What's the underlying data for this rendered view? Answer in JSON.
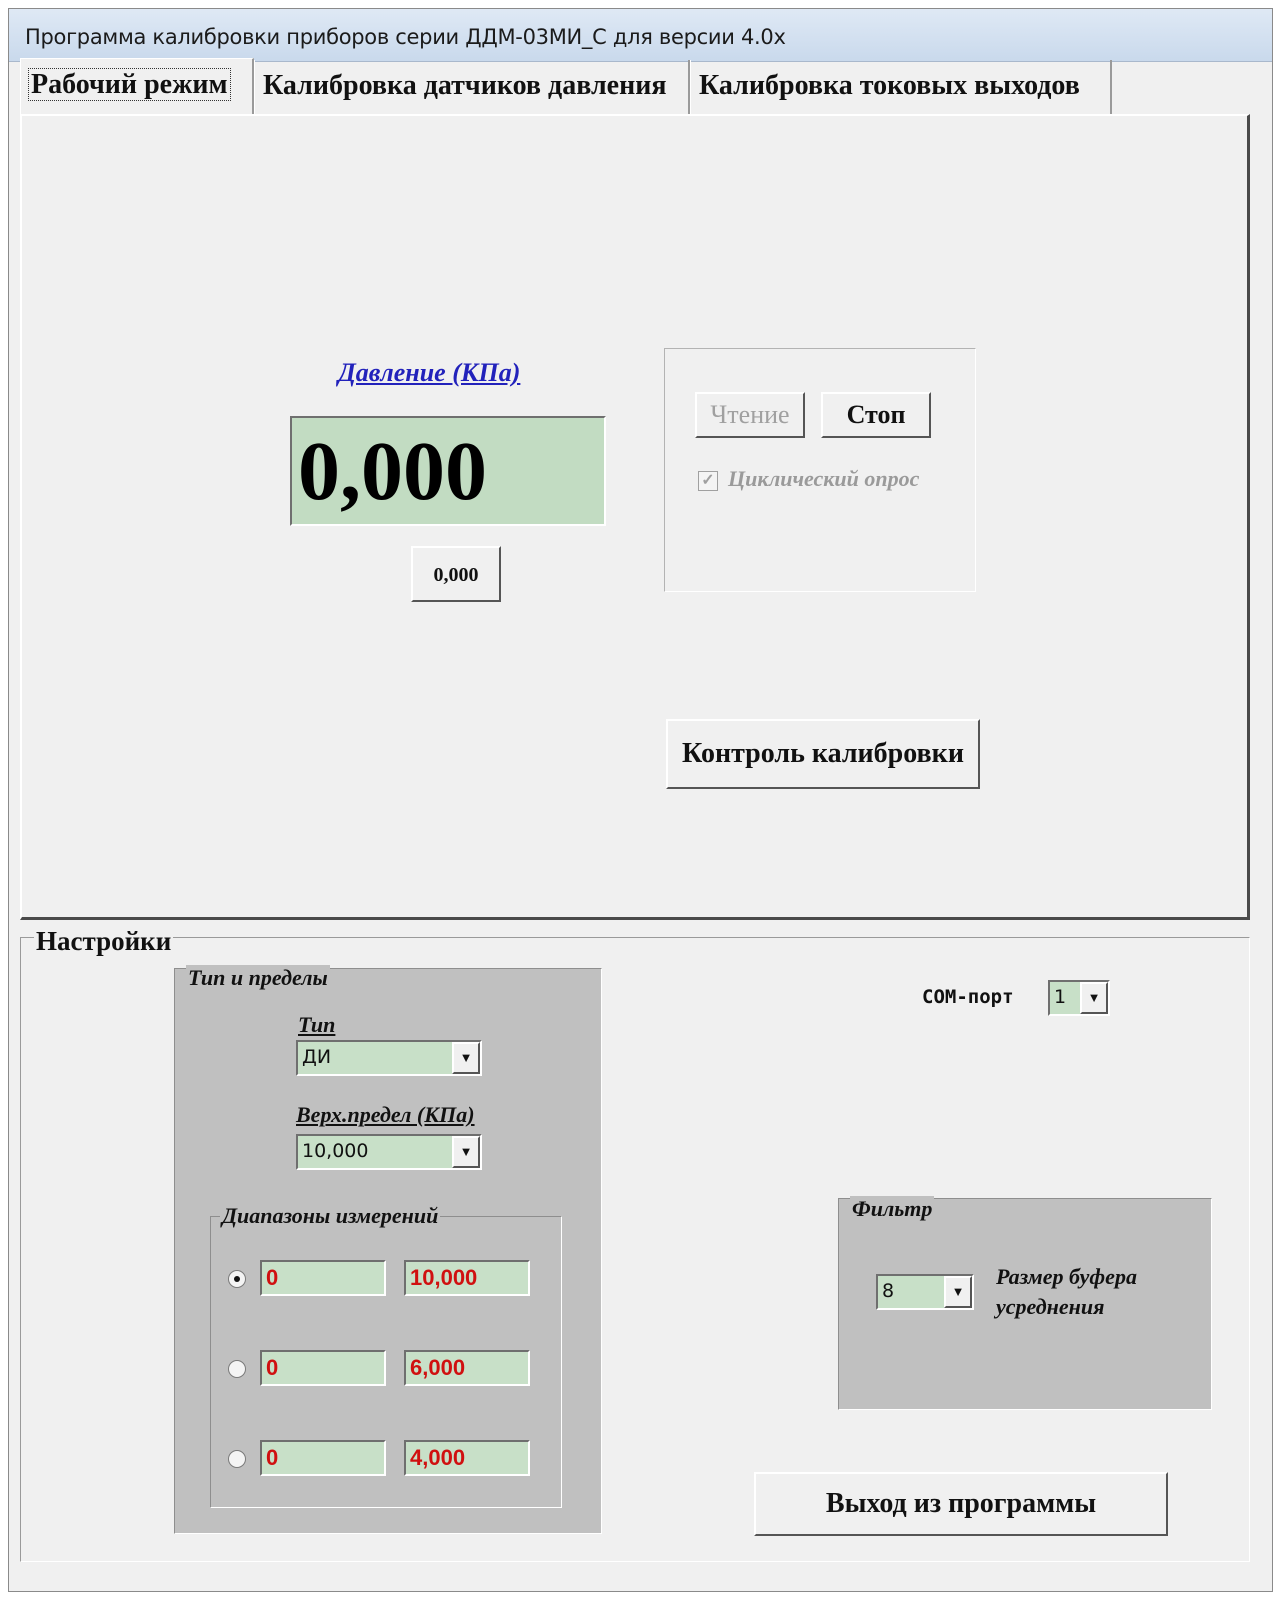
{
  "window": {
    "title": "Программа калибровки приборов серии ДДМ-03МИ_С для версии 4.0х"
  },
  "tabs": [
    {
      "label": "Рабочий режим",
      "active": true
    },
    {
      "label": "Калибровка датчиков давления",
      "active": false
    },
    {
      "label": "Калибровка токовых выходов",
      "active": false
    }
  ],
  "work": {
    "pressure_label": "Давление (КПа)",
    "pressure_value": "0,000",
    "small_value_button": "0,000",
    "read_button": "Чтение",
    "stop_button": "Стоп",
    "cyclic_label": "Циклический опрос",
    "cyclic_checked": true,
    "calib_control_button": "Контроль калибровки"
  },
  "settings": {
    "title": "Настройки",
    "type_limits": {
      "title": "Тип и пределы",
      "type_label": "Тип",
      "type_value": "ДИ",
      "upper_limit_label": "Верх.предел (КПа)",
      "upper_limit_value": "10,000"
    },
    "ranges": {
      "title": "Диапазоны измерений",
      "rows": [
        {
          "selected": true,
          "min": "0",
          "max": "10,000"
        },
        {
          "selected": false,
          "min": "0",
          "max": "6,000"
        },
        {
          "selected": false,
          "min": "0",
          "max": "4,000"
        }
      ]
    },
    "com_port": {
      "label": "СОМ-порт",
      "value": "1"
    },
    "filter": {
      "title": "Фильтр",
      "buffer_value": "8",
      "buffer_label": "Размер буфера усреднения"
    },
    "exit_button": "Выход из программы"
  },
  "colors": {
    "display_bg": "#c2dcc2",
    "range_text": "#d01010",
    "link_blue": "#2222bb",
    "panel_gray": "#c0c0c0"
  }
}
